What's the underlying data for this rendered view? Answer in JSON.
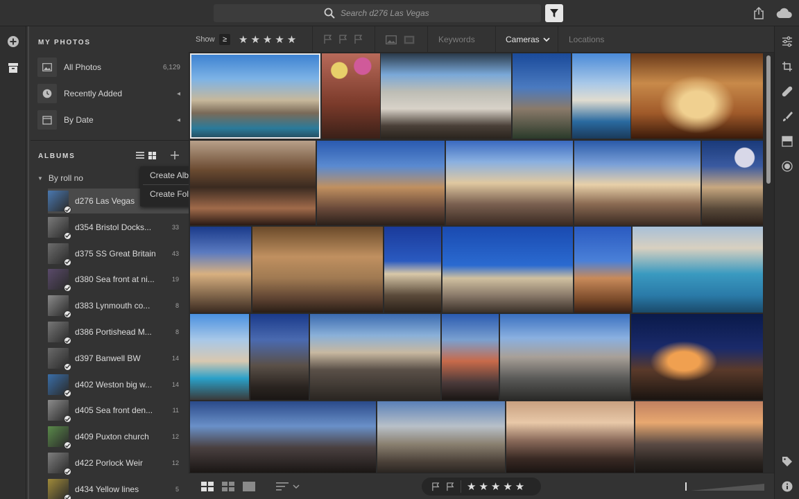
{
  "search": {
    "placeholder": "Search d276 Las Vegas"
  },
  "sidebar": {
    "my_photos_title": "MY PHOTOS",
    "nav": [
      {
        "label": "All Photos",
        "meta": "6,129",
        "icon": "photo-icon"
      },
      {
        "label": "Recently Added",
        "meta": "◂",
        "icon": "clock-icon"
      },
      {
        "label": "By Date",
        "meta": "◂",
        "icon": "calendar-icon"
      }
    ],
    "albums_title": "ALBUMS",
    "roll_label": "By roll no",
    "albums": [
      {
        "name": "d276 Las Vegas",
        "count": "",
        "color": "#4a78b0"
      },
      {
        "name": "d354 Bristol Docks...",
        "count": "33",
        "color": "#7a7a7a"
      },
      {
        "name": "d375 SS Great Britain",
        "count": "43",
        "color": "#6d6d6d"
      },
      {
        "name": "d380 Sea front at ni...",
        "count": "19",
        "color": "#5a4a6a"
      },
      {
        "name": "d383 Lynmouth co...",
        "count": "8",
        "color": "#8a8a8a"
      },
      {
        "name": "d386 Portishead M...",
        "count": "8",
        "color": "#777777"
      },
      {
        "name": "d397 Banwell BW",
        "count": "14",
        "color": "#6a6a6a"
      },
      {
        "name": "d402 Weston big w...",
        "count": "14",
        "color": "#3a6ea8"
      },
      {
        "name": "d405 Sea front den...",
        "count": "11",
        "color": "#8c8c8c"
      },
      {
        "name": "d409 Puxton church",
        "count": "12",
        "color": "#5a8a4a"
      },
      {
        "name": "d422 Porlock Weir",
        "count": "12",
        "color": "#7e7e7e"
      },
      {
        "name": "d434 Yellow lines",
        "count": "5",
        "color": "#a08a3a"
      }
    ]
  },
  "popup": {
    "create_album": "Create Album",
    "create_folder": "Create Folder"
  },
  "filterbar": {
    "show_label": "Show",
    "gte_symbol": "≥",
    "stars": "★★★★★",
    "keywords": "Keywords",
    "cameras": "Cameras",
    "locations": "Locations"
  },
  "bottombar": {
    "stars": "★★★★★"
  },
  "colors": {
    "accent": "#e6e6e6",
    "background": "#2b2b2b",
    "panel": "#333333"
  }
}
